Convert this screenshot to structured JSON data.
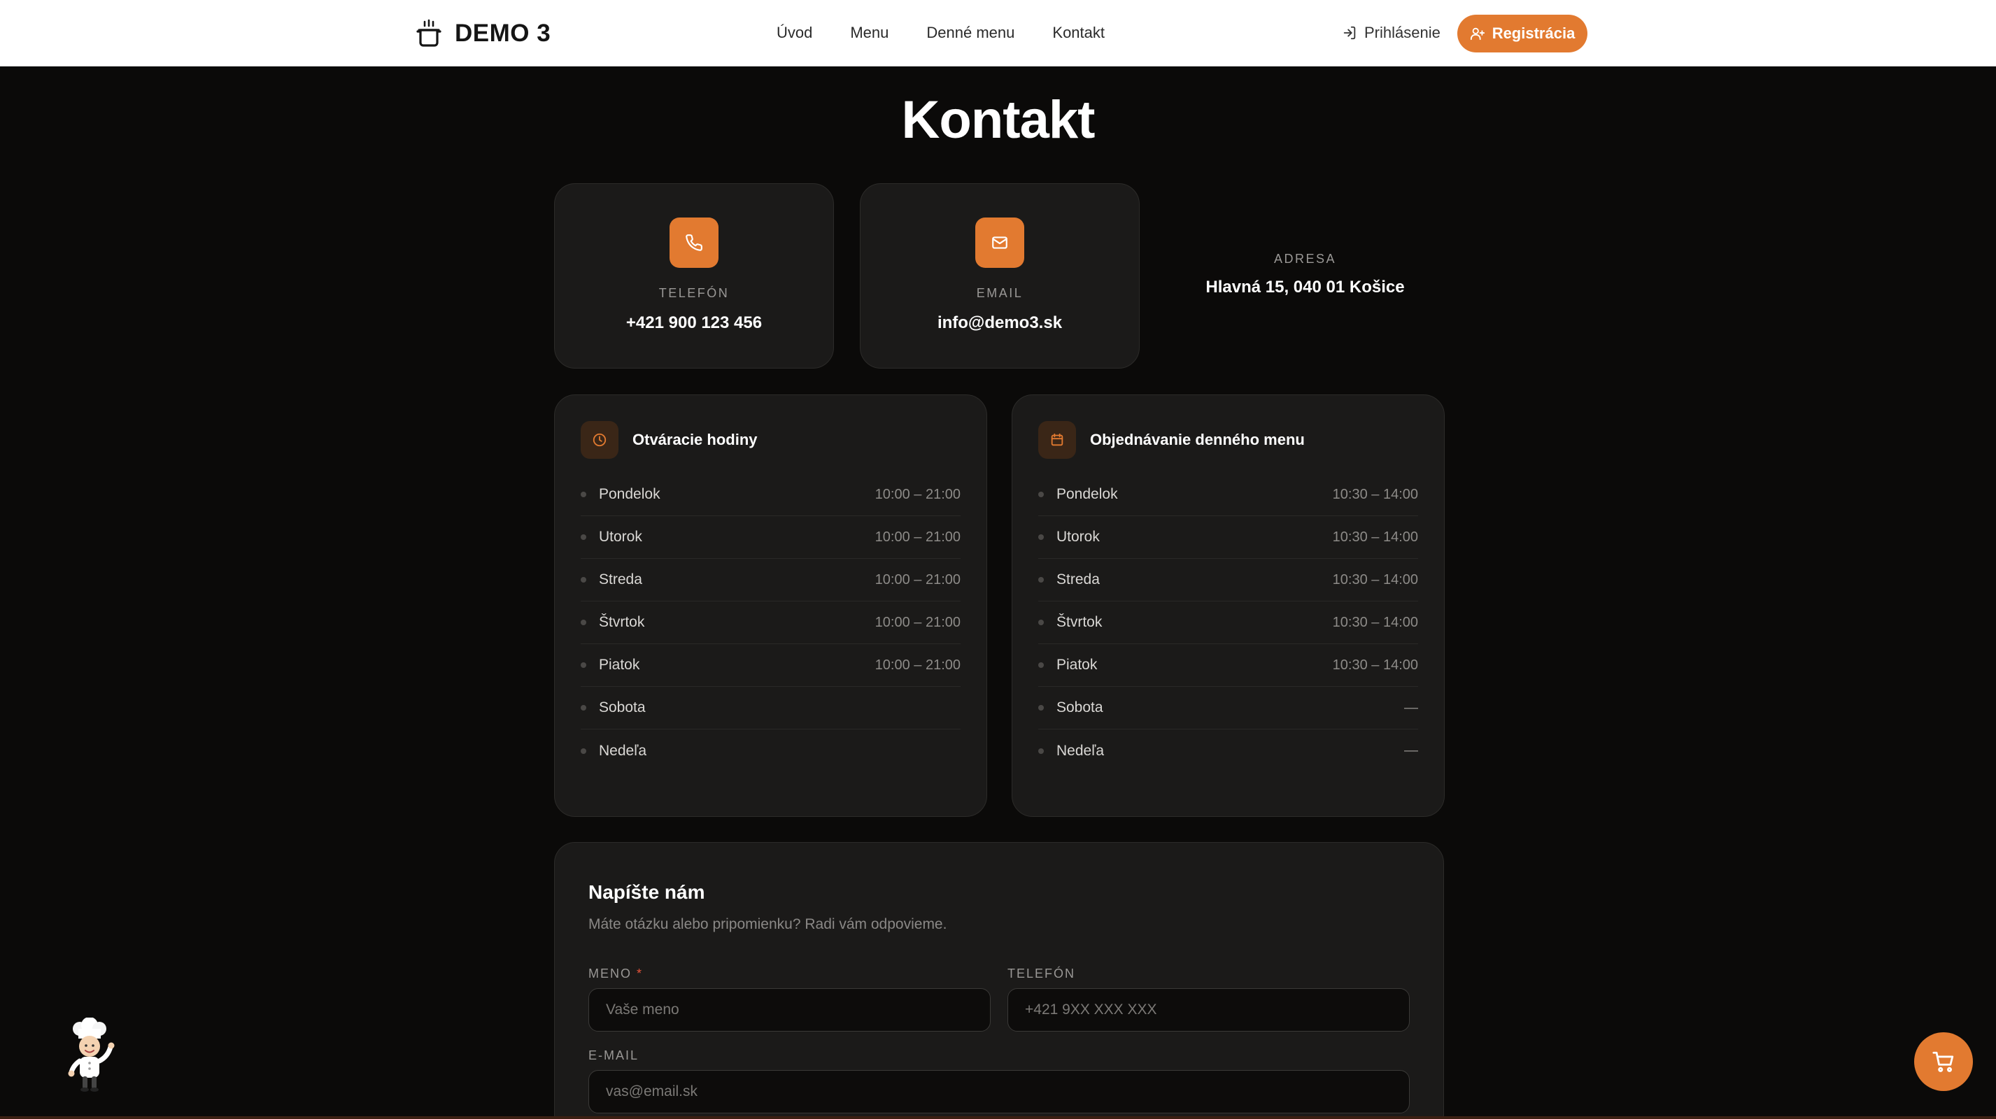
{
  "header": {
    "brand": "DEMO 3",
    "nav": [
      "Úvod",
      "Menu",
      "Denné menu",
      "Kontakt"
    ],
    "login_label": "Prihlásenie",
    "register_label": "Registrácia"
  },
  "page": {
    "title": "Kontakt"
  },
  "contact": {
    "phone": {
      "label": "TELEFÓN",
      "value": "+421 900 123 456"
    },
    "email": {
      "label": "EMAIL",
      "value": "info@demo3.sk"
    },
    "address": {
      "label": "ADRESA",
      "value": "Hlavná 15, 040 01 Košice"
    }
  },
  "opening_hours": {
    "title": "Otváracie hodiny",
    "rows": [
      {
        "day": "Pondelok",
        "time": "10:00 – 21:00"
      },
      {
        "day": "Utorok",
        "time": "10:00 – 21:00"
      },
      {
        "day": "Streda",
        "time": "10:00 – 21:00"
      },
      {
        "day": "Štvrtok",
        "time": "10:00 – 21:00"
      },
      {
        "day": "Piatok",
        "time": "10:00 – 21:00"
      },
      {
        "day": "Sobota",
        "time": ""
      },
      {
        "day": "Nedeľa",
        "time": ""
      }
    ]
  },
  "menu_ordering": {
    "title": "Objednávanie denného menu",
    "rows": [
      {
        "day": "Pondelok",
        "time": "10:30 – 14:00"
      },
      {
        "day": "Utorok",
        "time": "10:30 – 14:00"
      },
      {
        "day": "Streda",
        "time": "10:30 – 14:00"
      },
      {
        "day": "Štvrtok",
        "time": "10:30 – 14:00"
      },
      {
        "day": "Piatok",
        "time": "10:30 – 14:00"
      },
      {
        "day": "Sobota",
        "time": "—"
      },
      {
        "day": "Nedeľa",
        "time": "—"
      }
    ]
  },
  "form": {
    "title": "Napíšte nám",
    "subtitle": "Máte otázku alebo pripomienku? Radi vám odpovieme.",
    "name_label": "MENO",
    "required_mark": "*",
    "name_placeholder": "Vaše meno",
    "phone_label": "TELEFÓN",
    "phone_placeholder": "+421 9XX XXX XXX",
    "email_label": "E-MAIL",
    "email_placeholder": "vas@email.sk"
  },
  "icons": {
    "logo": "cooking-pot-icon",
    "login": "login-icon",
    "register": "user-plus-icon",
    "phone": "phone-icon",
    "email": "mail-icon",
    "hours": "clock-icon",
    "ordering": "calendar-icon",
    "cart": "cart-icon",
    "mascot": "chef-mascot"
  },
  "colors": {
    "accent": "#e27a30",
    "background": "#0b0a09",
    "card": "#1b1a19",
    "header": "#ffffff"
  }
}
